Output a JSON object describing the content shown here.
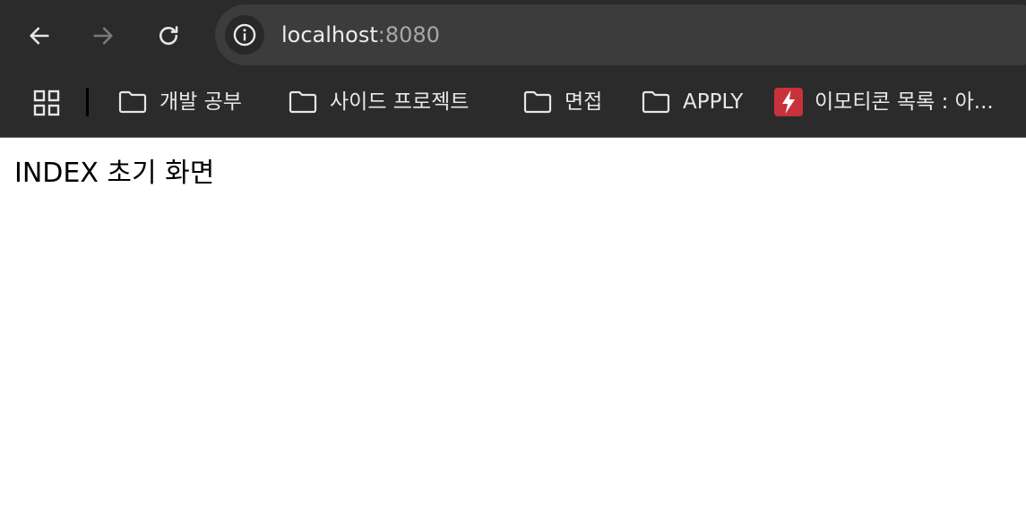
{
  "toolbar": {
    "back_icon": "arrow-left-icon",
    "forward_icon": "arrow-right-icon",
    "reload_icon": "reload-icon",
    "site_info_icon": "info-icon"
  },
  "address_bar": {
    "host": "localhost",
    "port": ":8080"
  },
  "bookmarks": {
    "apps_icon": "apps-grid-icon",
    "items": [
      {
        "label": "개발 공부",
        "icon": "folder-icon"
      },
      {
        "label": "사이드 프로젝트",
        "icon": "folder-icon"
      },
      {
        "label": "면접",
        "icon": "folder-icon"
      },
      {
        "label": "APPLY",
        "icon": "folder-icon"
      },
      {
        "label": "이모티콘 목록 : 아...",
        "icon": "bolt-favicon-icon"
      }
    ]
  },
  "colors": {
    "chrome_bg": "#2b2b2b",
    "omnibox_bg": "#3c3c3c",
    "favicon_red": "#c8323c"
  },
  "page": {
    "heading": "INDEX 초기 화면"
  }
}
